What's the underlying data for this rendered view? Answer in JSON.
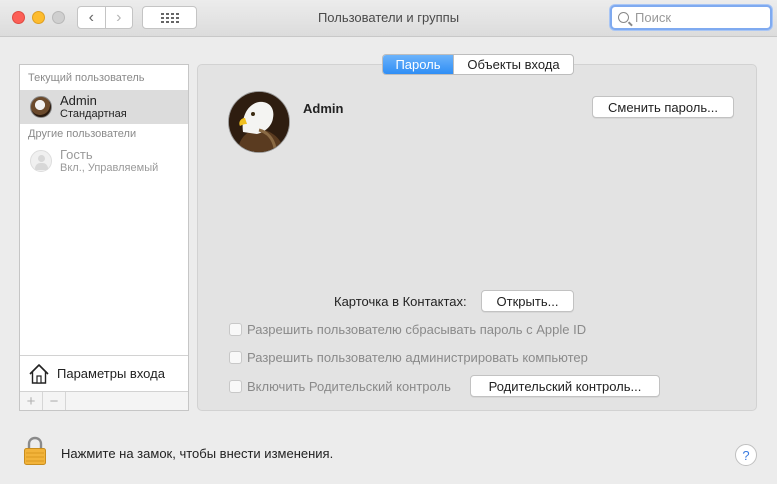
{
  "window": {
    "title": "Пользователи и группы",
    "search_placeholder": "Поиск"
  },
  "sidebar": {
    "current_header": "Текущий пользователь",
    "other_header": "Другие пользователи",
    "users": [
      {
        "name": "Admin",
        "role": "Стандартная",
        "selected": true
      },
      {
        "name": "Гость",
        "role": "Вкл., Управляемый",
        "selected": false
      }
    ],
    "login_options_label": "Параметры входа",
    "add_label": "+",
    "remove_label": "−"
  },
  "tabs": [
    {
      "label": "Пароль",
      "active": true
    },
    {
      "label": "Объекты входа",
      "active": false
    }
  ],
  "main": {
    "user_name": "Admin",
    "change_password_label": "Сменить пароль...",
    "contacts_card_label": "Карточка в Контактах:",
    "open_label": "Открыть...",
    "checkboxes": [
      {
        "label": "Разрешить пользователю сбрасывать пароль с Apple ID",
        "checked": false
      },
      {
        "label": "Разрешить пользователю администрировать компьютер",
        "checked": false
      },
      {
        "label": "Включить Родительский контроль",
        "checked": false
      }
    ],
    "parental_controls_label": "Родительский контроль..."
  },
  "footer": {
    "lock_text": "Нажмите на замок, чтобы внести изменения.",
    "help_label": "?"
  },
  "colors": {
    "accent": "#2f8ef5",
    "close": "#fc5f57",
    "minimize": "#fdbc2e",
    "lock": "#f2b33a"
  }
}
